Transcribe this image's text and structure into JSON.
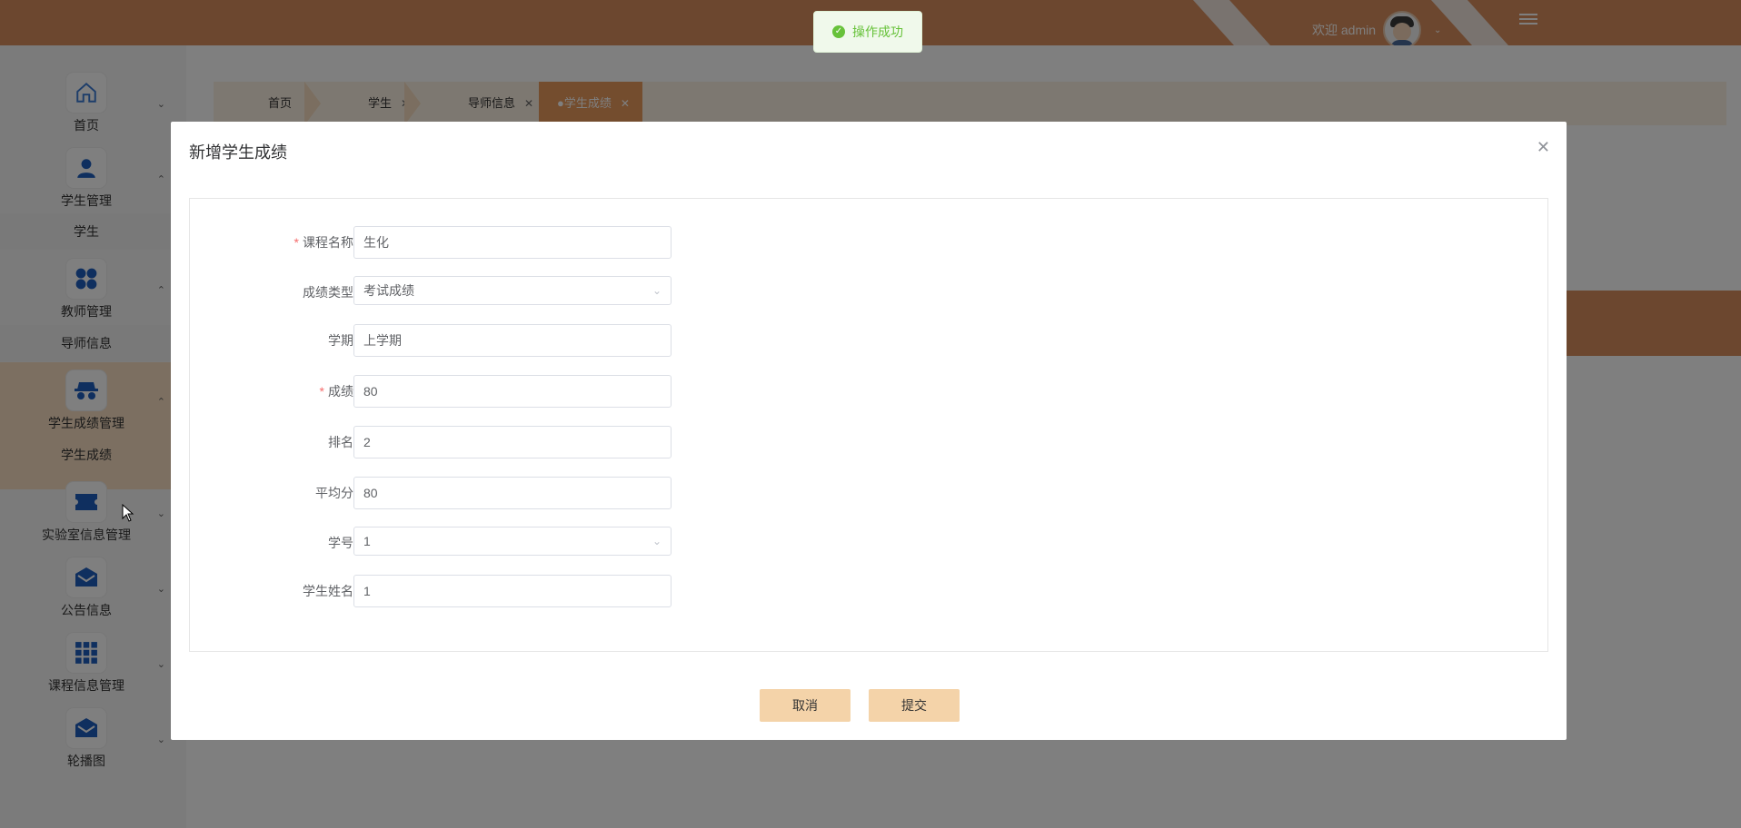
{
  "toast": {
    "text": "操作成功"
  },
  "header": {
    "welcome": "欢迎 admin"
  },
  "sidebar": {
    "items": [
      {
        "label": "首页"
      },
      {
        "label": "学生管理"
      },
      {
        "label": "学生"
      },
      {
        "label": "教师管理"
      },
      {
        "label": "导师信息"
      },
      {
        "label": "学生成绩管理"
      },
      {
        "label": "学生成绩"
      },
      {
        "label": "实验室信息管理"
      },
      {
        "label": "公告信息"
      },
      {
        "label": "课程信息管理"
      },
      {
        "label": "轮播图"
      }
    ]
  },
  "tabs": [
    {
      "label": "首页"
    },
    {
      "label": "学生"
    },
    {
      "label": "导师信息"
    },
    {
      "label": "●学生成绩"
    }
  ],
  "dialog": {
    "title": "新增学生成绩",
    "fields": [
      {
        "label": "课程名称",
        "required": true,
        "value": "生化"
      },
      {
        "label": "成绩类型",
        "required": false,
        "value": "考试成绩",
        "type": "select"
      },
      {
        "label": "学期",
        "required": false,
        "value": "上学期"
      },
      {
        "label": "成绩",
        "required": true,
        "value": "80"
      },
      {
        "label": "排名",
        "required": false,
        "value": "2"
      },
      {
        "label": "平均分",
        "required": false,
        "value": "80"
      },
      {
        "label": "学号",
        "required": false,
        "value": "1",
        "type": "select"
      },
      {
        "label": "学生姓名",
        "required": false,
        "value": "1"
      }
    ],
    "cancel_label": "取消",
    "submit_label": "提交"
  }
}
